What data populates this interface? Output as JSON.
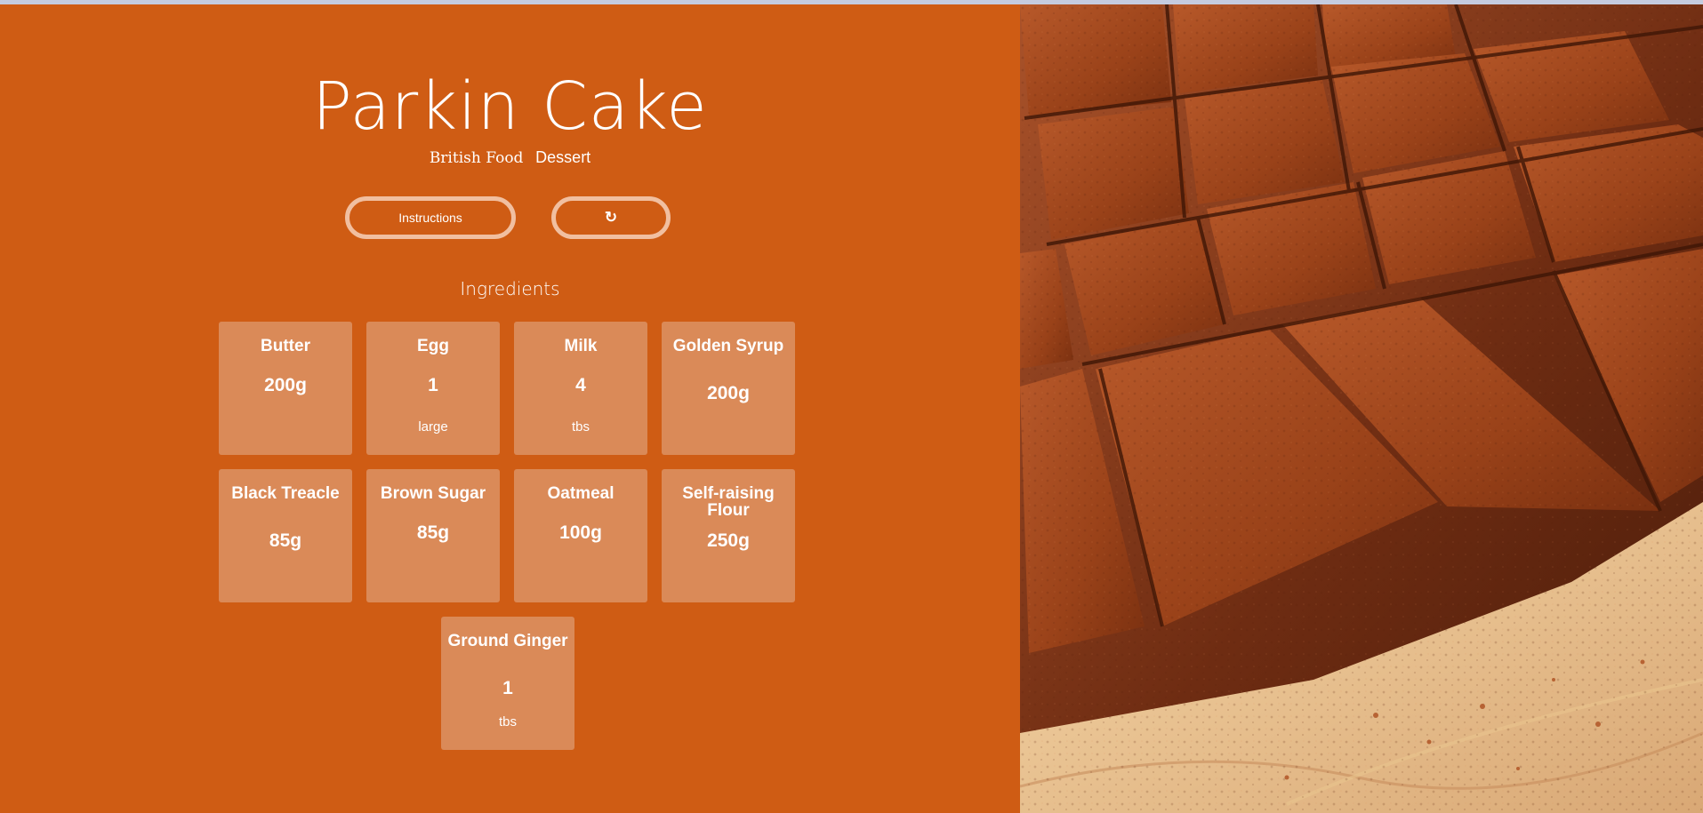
{
  "recipe": {
    "title": "Parkin Cake",
    "area": "British Food",
    "category": "Dessert"
  },
  "buttons": {
    "instructions_label": "Instructions",
    "refresh_icon": "refresh-icon",
    "refresh_glyph": "↻"
  },
  "ingredients": {
    "heading": "Ingredients",
    "items": [
      {
        "name": "Butter",
        "qty": "200g",
        "unit": ""
      },
      {
        "name": "Egg",
        "qty": "1",
        "unit": "large"
      },
      {
        "name": "Milk",
        "qty": "4",
        "unit": "tbs"
      },
      {
        "name": "Golden Syrup",
        "qty": "200g",
        "unit": ""
      },
      {
        "name": "Black Treacle",
        "qty": "85g",
        "unit": ""
      },
      {
        "name": "Brown Sugar",
        "qty": "85g",
        "unit": ""
      },
      {
        "name": "Oatmeal",
        "qty": "100g",
        "unit": ""
      },
      {
        "name": "Self-raising Flour",
        "qty": "250g",
        "unit": ""
      },
      {
        "name": "Ground Ginger",
        "qty": "1",
        "unit": "tbs"
      }
    ]
  },
  "colors": {
    "panel": "#cf5c14",
    "card": "#da8a58",
    "button_border": "#f1bfa0"
  }
}
